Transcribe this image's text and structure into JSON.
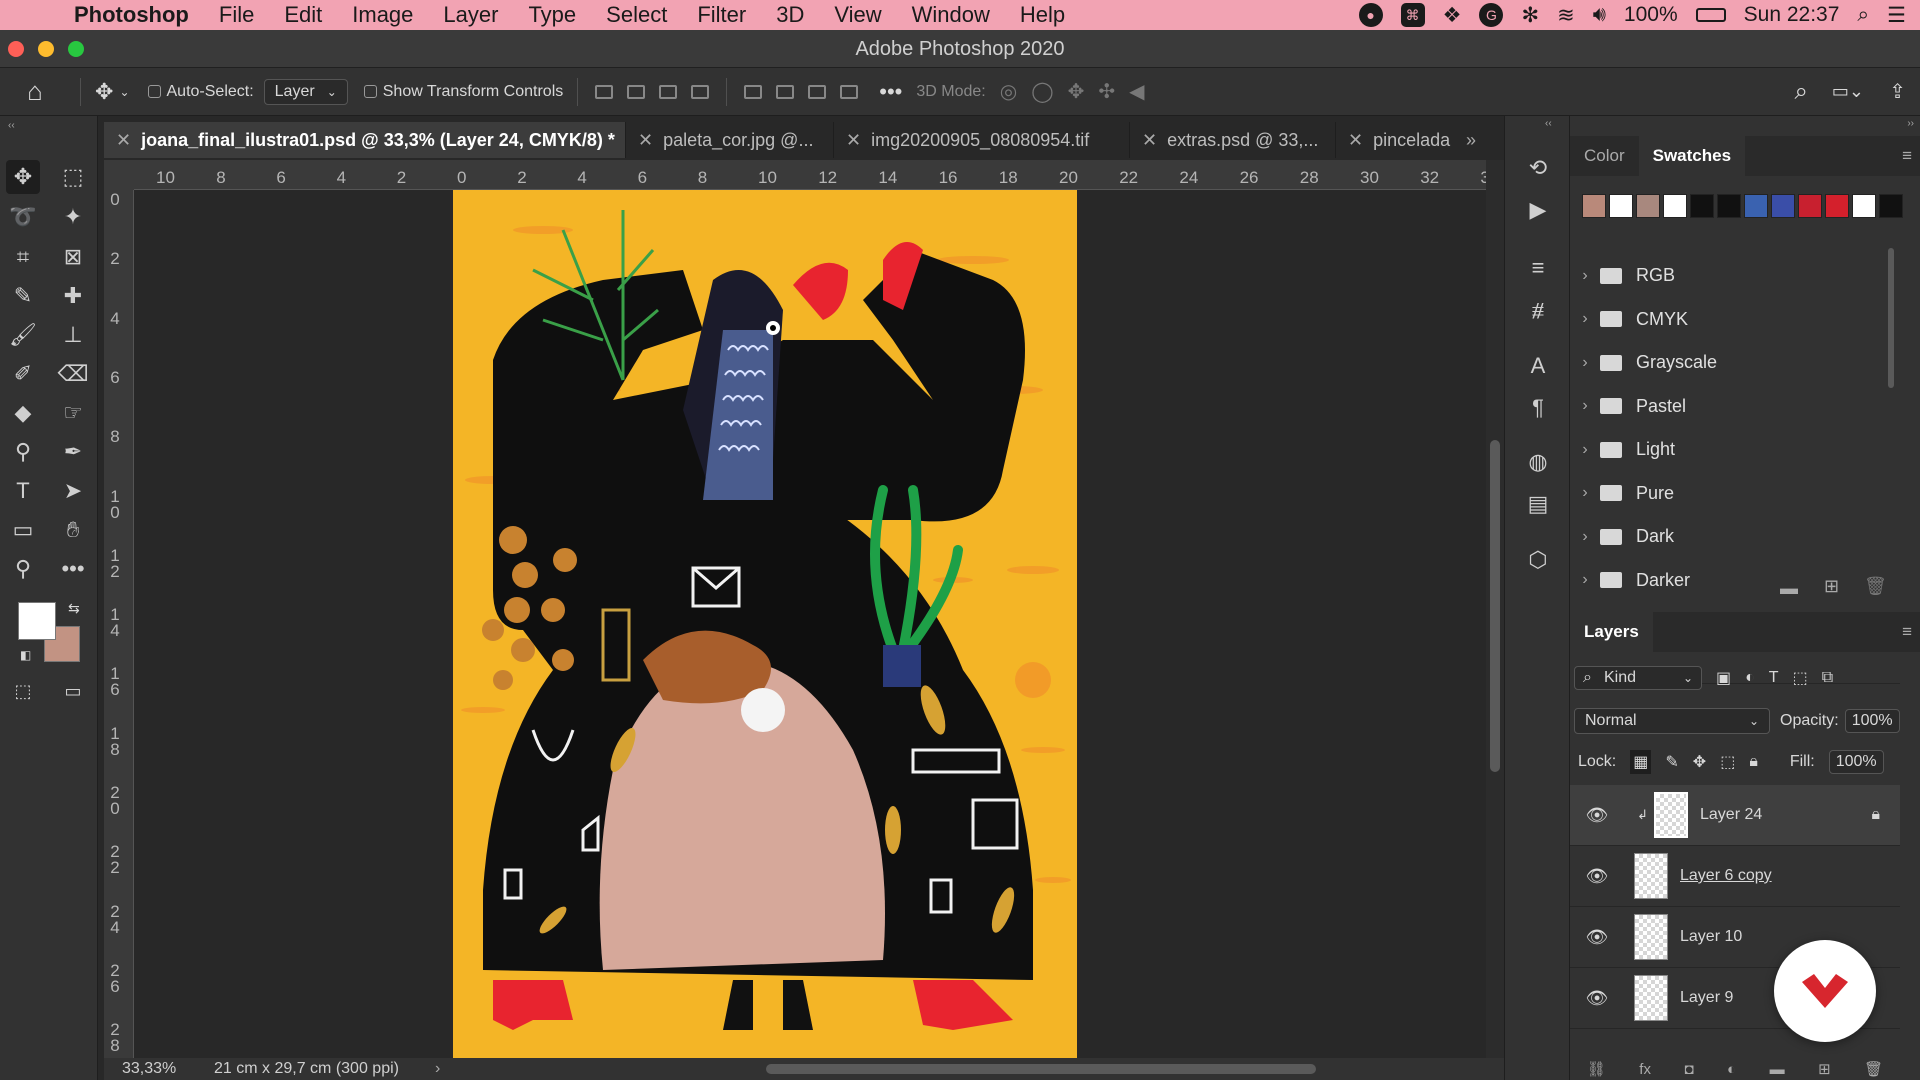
{
  "menubar": {
    "app_name": "Photoshop",
    "items": [
      "File",
      "Edit",
      "Image",
      "Layer",
      "Type",
      "Select",
      "Filter",
      "3D",
      "View",
      "Window",
      "Help"
    ],
    "battery": "100%",
    "clock": "Sun 22:37"
  },
  "window": {
    "title": "Adobe Photoshop 2020"
  },
  "options_bar": {
    "auto_select_label": "Auto-Select:",
    "auto_select_value": "Layer",
    "transform_label": "Show Transform Controls",
    "mode_3d_label": "3D Mode:"
  },
  "tabs": [
    {
      "label": "joana_final_ilustra01.psd @ 33,3% (Layer 24, CMYK/8) *",
      "active": true
    },
    {
      "label": "paleta_cor.jpg @..."
    },
    {
      "label": "img20200905_08080954.tif"
    },
    {
      "label": "extras.psd @ 33,..."
    },
    {
      "label": "pincelada"
    }
  ],
  "ruler": {
    "h_ticks": [
      "10",
      "8",
      "6",
      "4",
      "2",
      "0",
      "2",
      "4",
      "6",
      "8",
      "10",
      "12",
      "14",
      "16",
      "18",
      "20",
      "22",
      "24",
      "26",
      "28",
      "30",
      "32",
      "3"
    ],
    "v_ticks": [
      "0",
      "2",
      "4",
      "6",
      "8",
      "1\n0",
      "1\n2",
      "1\n4",
      "1\n6",
      "1\n8",
      "2\n0",
      "2\n2",
      "2\n4",
      "2\n6",
      "2\n8"
    ]
  },
  "status": {
    "zoom": "33,33%",
    "doc_size": "21 cm x 29,7 cm (300 ppi)"
  },
  "swatches_panel": {
    "tabs": [
      "Color",
      "Swatches"
    ],
    "colors": [
      "#b9897a",
      "#ffffff",
      "#a8887e",
      "#ffffff",
      "#111111",
      "#111111",
      "#3a62b0",
      "#3a4ea8",
      "#c8202f",
      "#d4202c",
      "#ffffff",
      "#111111"
    ],
    "groups": [
      "RGB",
      "CMYK",
      "Grayscale",
      "Pastel",
      "Light",
      "Pure",
      "Dark",
      "Darker"
    ]
  },
  "layers_panel": {
    "title": "Layers",
    "filter_kind": "Kind",
    "blend_mode": "Normal",
    "opacity_label": "Opacity:",
    "opacity_value": "100%",
    "lock_label": "Lock:",
    "fill_label": "Fill:",
    "fill_value": "100%",
    "layers": [
      {
        "name": "Layer 24",
        "selected": true
      },
      {
        "name": "Layer 6 copy"
      },
      {
        "name": "Layer 10"
      },
      {
        "name": "Layer 9"
      }
    ]
  },
  "colors": {
    "accent_menubar": "#f2a3b3",
    "artboard_bg": "#f4b526",
    "fg_color": "#ffffff",
    "bg_color": "#c29383"
  }
}
